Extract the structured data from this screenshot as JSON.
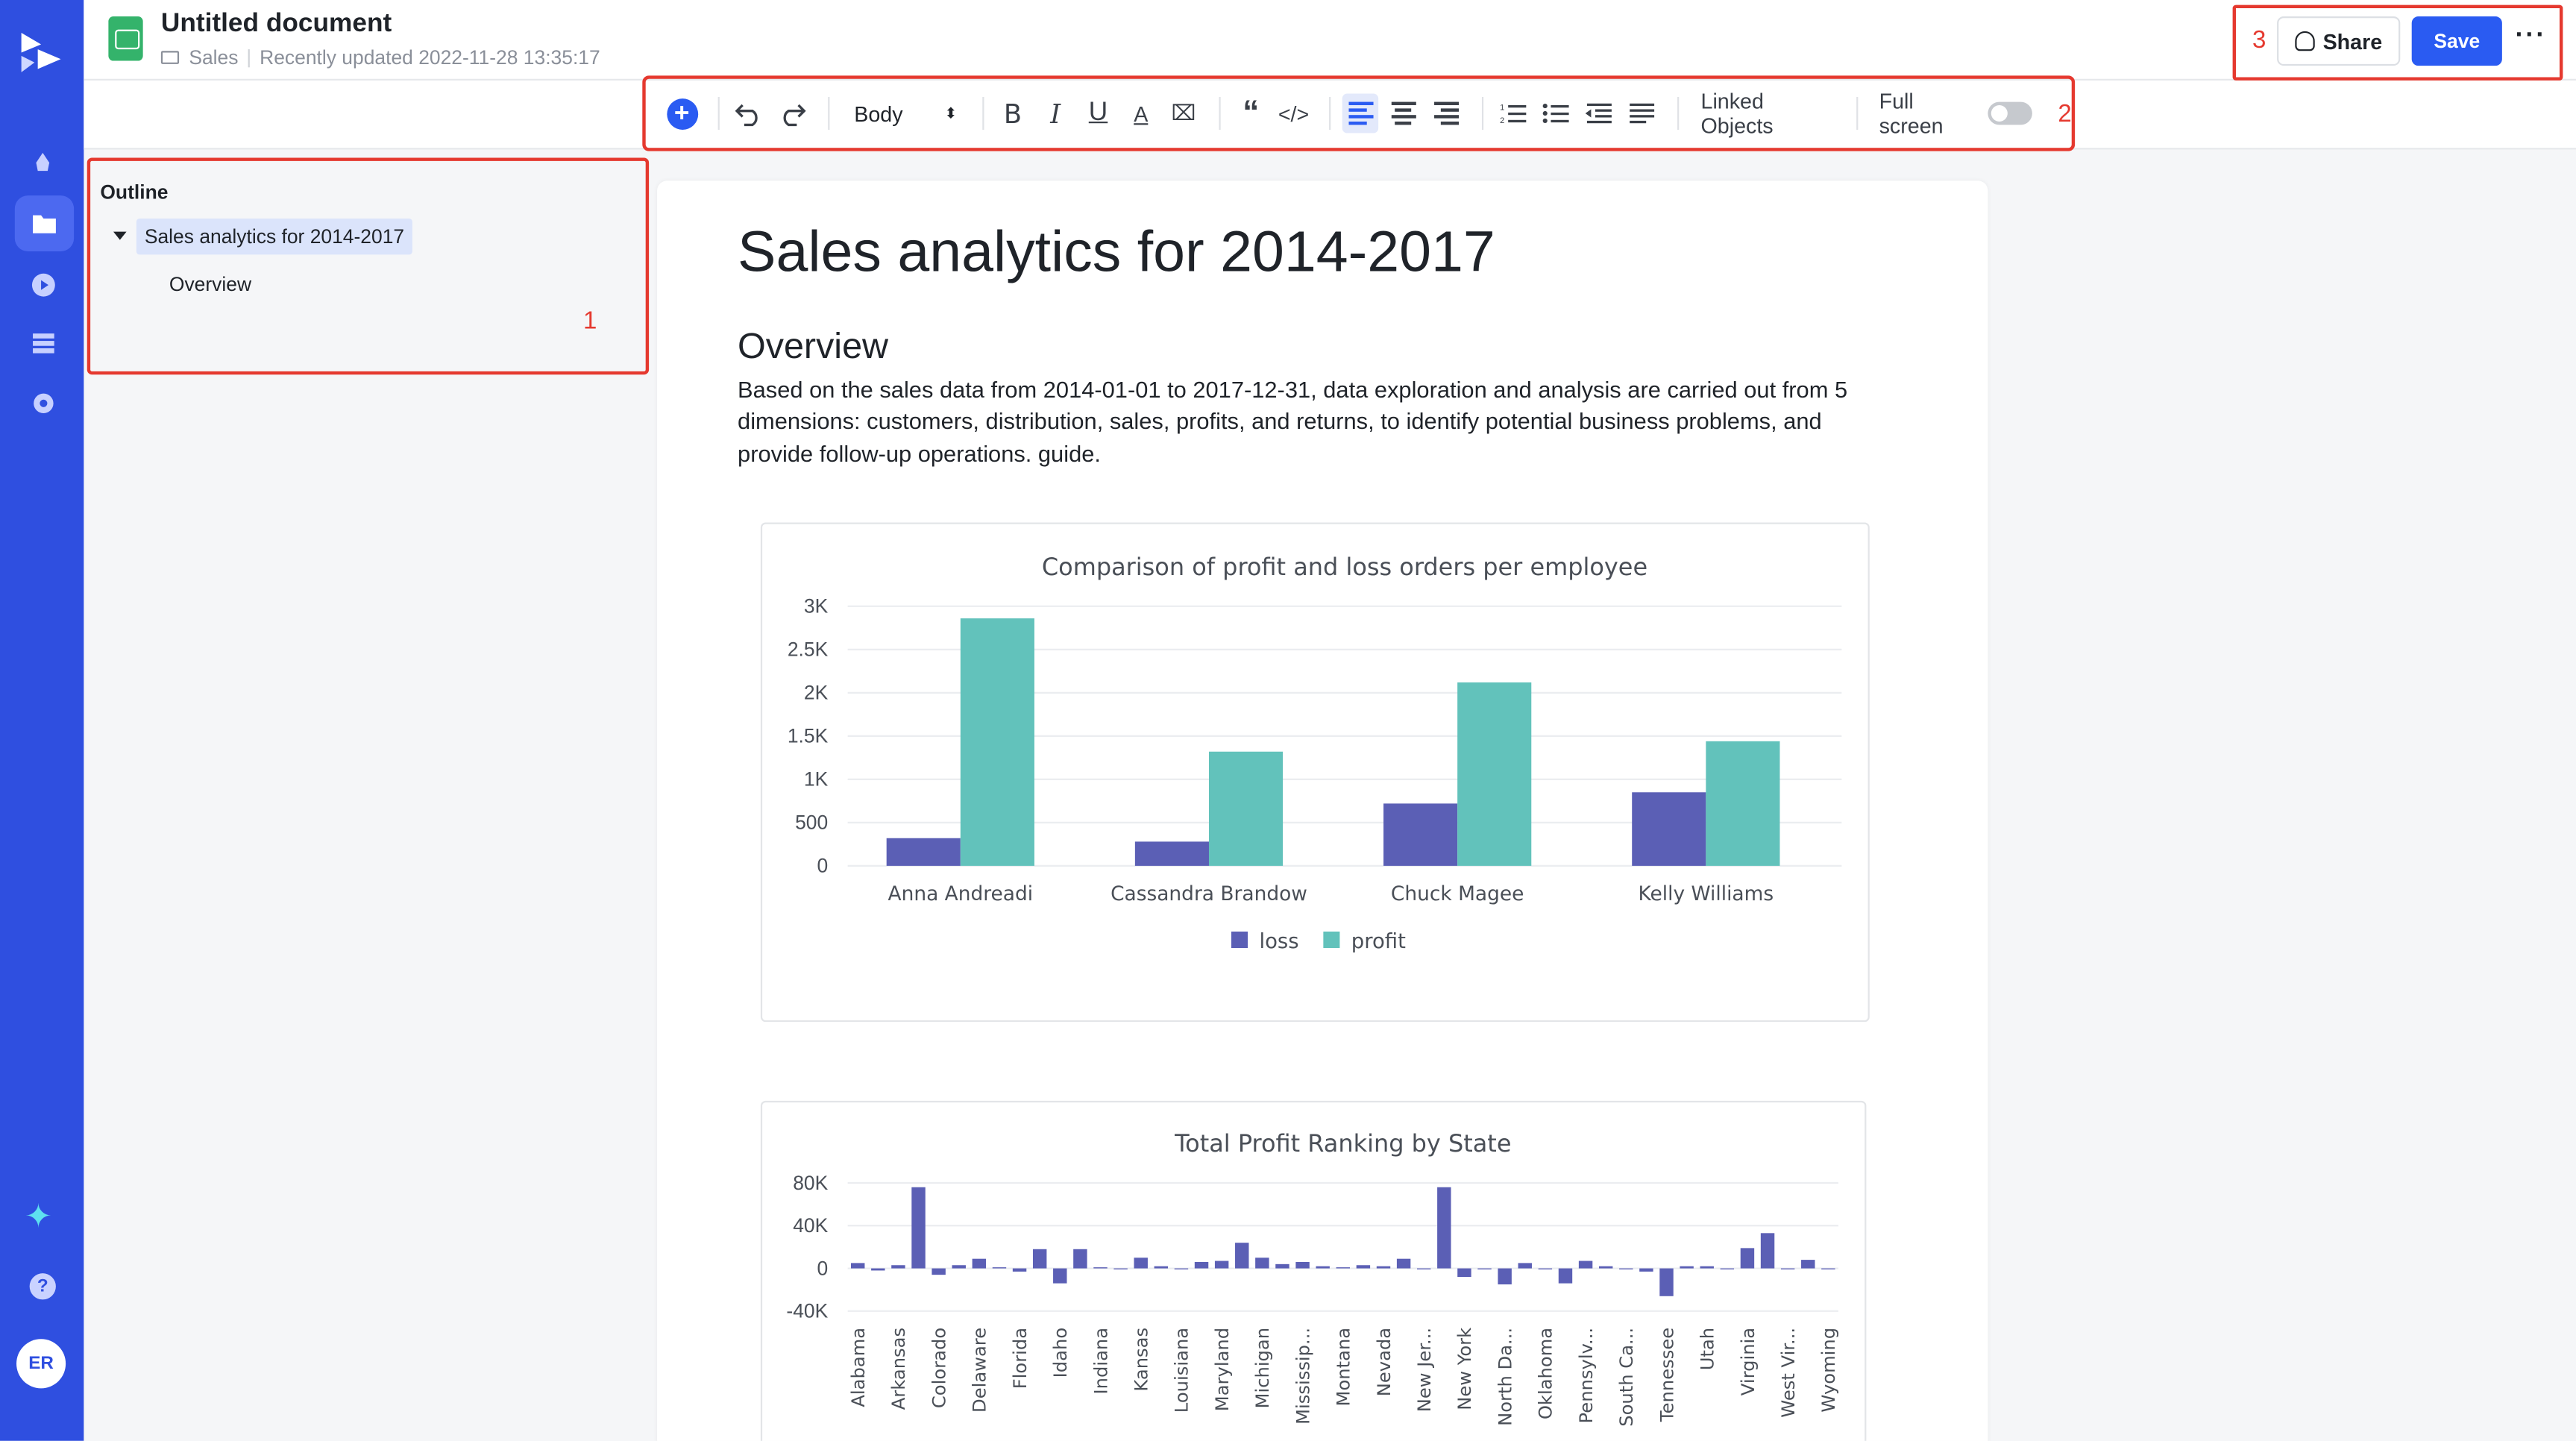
{
  "header": {
    "title": "Untitled document",
    "folder": "Sales",
    "updated": "Recently updated 2022-11-28 13:35:17",
    "region_number": "3",
    "share_label": "Share",
    "save_label": "Save",
    "more_label": "···"
  },
  "rail": {
    "avatar": "ER",
    "help": "?",
    "icons": [
      "rocket-icon",
      "folder-icon",
      "play-icon",
      "stack-icon",
      "settings-icon",
      "sparkle-icon",
      "help-icon"
    ]
  },
  "toolbar": {
    "text_style": "Body",
    "linked_objects": "Linked Objects",
    "full_screen": "Full screen",
    "region_number": "2",
    "full_screen_on": false
  },
  "outline": {
    "title": "Outline",
    "item": "Sales analytics for 2014-2017",
    "sub": "Overview",
    "region_number": "1"
  },
  "document": {
    "heading": "Sales analytics for 2014-2017",
    "subheading": "Overview",
    "paragraph": "Based on the sales data from 2014-01-01 to 2017-12-31, data exploration and analysis are carried out from 5 dimensions: customers, distribution, sales, profits, and returns, to identify potential business problems, and provide follow-up operations. guide."
  },
  "colors": {
    "accent": "#2a5bf2",
    "rail": "#2f4fe0",
    "loss": "#5b5fb5",
    "profit": "#62c2bb",
    "highlight": "#e5392f"
  },
  "chart_data": [
    {
      "type": "bar",
      "title": "Comparison of profit and loss orders per employee",
      "categories": [
        "Anna Andreadi",
        "Cassandra Brandow",
        "Chuck Magee",
        "Kelly Williams"
      ],
      "series": [
        {
          "name": "loss",
          "values": [
            320,
            280,
            720,
            850
          ]
        },
        {
          "name": "profit",
          "values": [
            2860,
            1320,
            2120,
            1440
          ]
        }
      ],
      "ylim": [
        0,
        3000
      ],
      "yticks": [
        "0",
        "500",
        "1K",
        "1.5K",
        "2K",
        "2.5K",
        "3K"
      ],
      "grid": true,
      "legend": "bottom"
    },
    {
      "type": "bar",
      "title": "Total Profit Ranking by State",
      "states": [
        "Alabama",
        "",
        "Arkansas",
        "",
        "Colorado",
        "",
        "Delaware",
        "",
        "Florida",
        "",
        "Idaho",
        "",
        "Indiana",
        "",
        "Kansas",
        "",
        "Louisiana",
        "",
        "Maryland",
        "",
        "Michigan",
        "",
        "Mississip...",
        "",
        "Montana",
        "",
        "Nevada",
        "",
        "New Jer...",
        "",
        "New York",
        "",
        "North Da...",
        "",
        "Oklahoma",
        "",
        "Pennsylv...",
        "",
        "South Ca...",
        "",
        "Tennessee",
        "",
        "Utah",
        "",
        "Virginia",
        "",
        "West Vir...",
        "",
        "Wyoming"
      ],
      "values": [
        5000,
        -2000,
        3000,
        76000,
        -6000,
        3000,
        9000,
        1000,
        -3000,
        18000,
        -14000,
        18000,
        1000,
        0,
        10000,
        2000,
        0,
        6000,
        7000,
        24000,
        10000,
        4000,
        6000,
        2000,
        1000,
        3000,
        2000,
        9000,
        0,
        76000,
        -8000,
        0,
        -15000,
        5000,
        0,
        -14000,
        7000,
        2000,
        0,
        -3000,
        -26000,
        2000,
        2000,
        0,
        19000,
        33000,
        0,
        8000,
        0
      ],
      "ylim": [
        -40000,
        80000
      ],
      "yticks": [
        "-40K",
        "0",
        "40K",
        "80K"
      ],
      "grid": true
    }
  ]
}
